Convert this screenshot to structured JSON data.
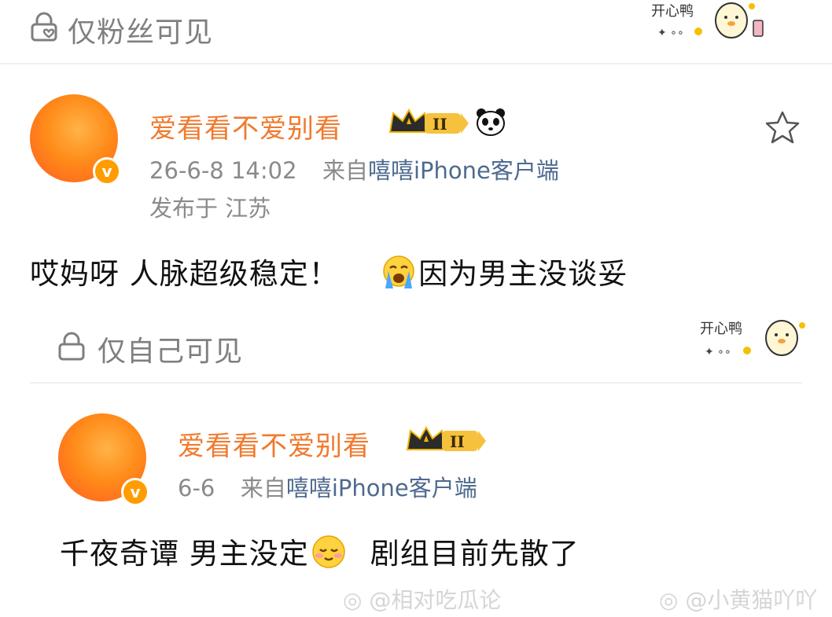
{
  "top_section": {
    "visibility_label": "仅粉丝可见",
    "sticker_text": "开心鸭"
  },
  "post1": {
    "username": "爱看看不爱别看",
    "level_badge": "II",
    "date": "26-6-8 14:02",
    "source_prefix": "来自",
    "source_app": "嘻嘻iPhone客户端",
    "location": "发布于 江苏",
    "text_a": "哎妈呀 人脉超级稳定！",
    "text_b": "因为男主没谈妥",
    "emoji": "crying-face-icon"
  },
  "middle_section": {
    "visibility_label": "仅自己可见",
    "sticker_text": "开心鸭"
  },
  "post2": {
    "username": "爱看看不爱别看",
    "level_badge": "II",
    "date": "6-6",
    "source_prefix": "来自",
    "source_app": "嘻嘻iPhone客户端",
    "text_a": "千夜奇谭 男主没定",
    "text_b": "剧组目前先散了",
    "emoji": "shy-smile-icon"
  },
  "watermarks": [
    "@相对吃瓜论",
    "@小黄猫吖吖"
  ],
  "colors": {
    "username": "#f07a2e",
    "source": "#4e6a8f",
    "meta": "#8a8a8a",
    "divider": "#efefef"
  }
}
